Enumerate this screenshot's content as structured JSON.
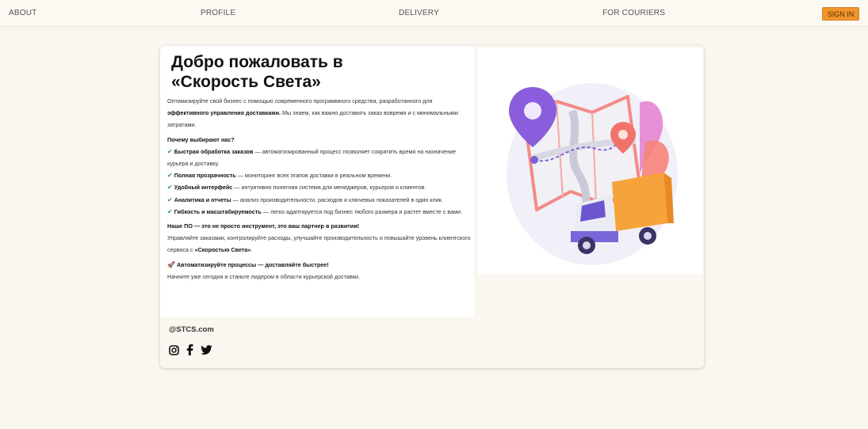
{
  "nav": {
    "about": "ABOUT",
    "profile": "PROFILE",
    "delivery": "DELIVERY",
    "for_couriers": "FOR COURIERS",
    "sign_in": "SIGN IN"
  },
  "hero": {
    "title_line1": "Добро пожаловать в",
    "title_line2": "«Скорость Света»",
    "intro_a": "Оптимизируйте свой бизнес с помощью современного программного средства, разработанного для ",
    "intro_bold": "эффективного управления доставками.",
    "intro_b": " Мы знаем, как важно доставить заказ вовремя и с минимальными затратами.",
    "why_heading": "Почему выбирают нас?",
    "features": [
      {
        "title": "Быстрая обработка заказов",
        "text": " — автоматизированный процесс позволяет сократить время на назначение курьера и доставку."
      },
      {
        "title": "Полная прозрачность",
        "text": " — мониторинг всех этапов доставки в реальном времени."
      },
      {
        "title": "Удобный интерфейс",
        "text": " — интуитивно понятная система для менеджеров, курьеров и клиентов."
      },
      {
        "title": "Аналитика и отчеты",
        "text": " — анализ производительности, расходов и ключевых показателей в один клик."
      },
      {
        "title": "Гибкость и масштабируемость",
        "text": " — легко адаптируется под бизнес любого размера и растет вместе с вами."
      }
    ],
    "partner_heading": "Наше ПО — это не просто инструмент, это ваш партнер в развитии!",
    "partner_a": "Управляйте заказами, контролируйте расходы, улучшайте производительность и повышайте уровень клиентского сервиса с ",
    "partner_bold": "«Скоростью Света»",
    "partner_b": ".",
    "cta_heading": "Автоматизируйте процессы — доставляйте быстрее!",
    "cta_text": "Начните уже сегодня и станьте лидером в области курьерской доставки."
  },
  "footer": {
    "domain": "@STCS.com",
    "social_icons": [
      "instagram-icon",
      "facebook-icon",
      "twitter-icon"
    ]
  },
  "colors": {
    "accent": "#f0952c",
    "background": "#faf6f0",
    "check": "#2e9c3a"
  }
}
